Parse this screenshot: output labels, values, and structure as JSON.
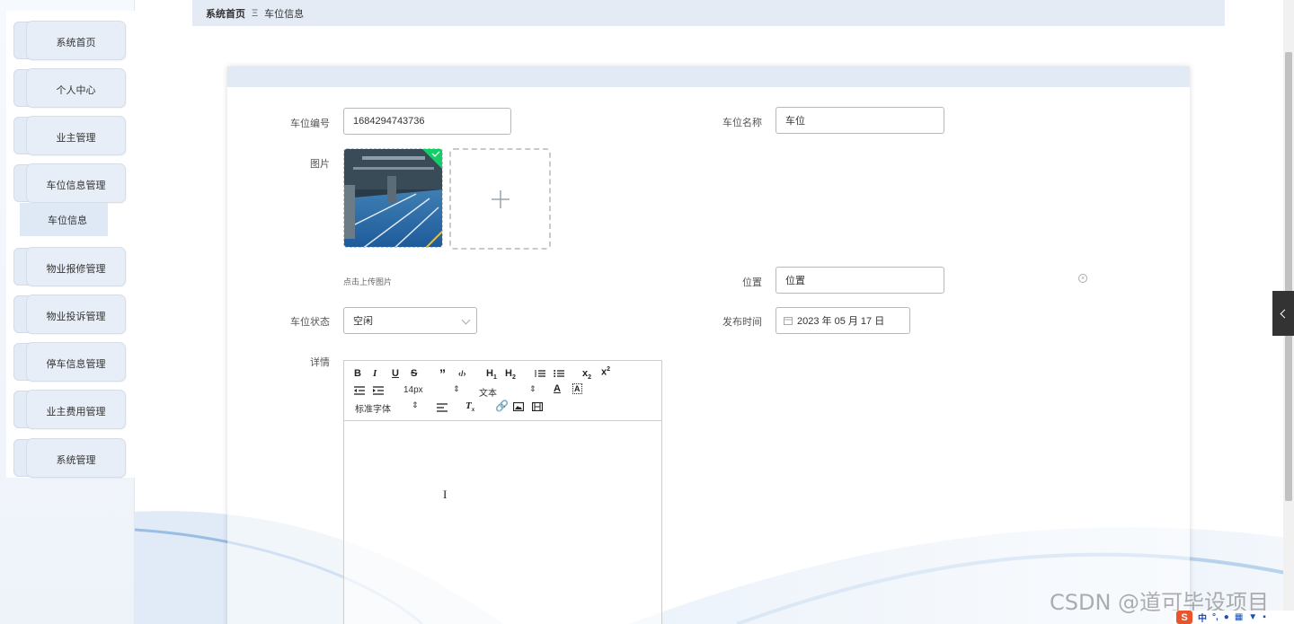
{
  "breadcrumb": {
    "home": "系统首页",
    "separator": "Ξ",
    "current": "车位信息"
  },
  "sidebar": {
    "items": [
      {
        "label": "系统首页"
      },
      {
        "label": "个人中心"
      },
      {
        "label": "业主管理"
      },
      {
        "label": "车位信息管理"
      },
      {
        "label": "物业报修管理"
      },
      {
        "label": "物业投诉管理"
      },
      {
        "label": "停车信息管理"
      },
      {
        "label": "业主费用管理"
      },
      {
        "label": "系统管理"
      }
    ],
    "submenu": {
      "label": "车位信息"
    }
  },
  "form": {
    "code_label": "车位编号",
    "code_value": "1684294743736",
    "name_label": "车位名称",
    "name_value": "车位",
    "image_label": "图片",
    "upload_tip": "点击上传图片",
    "location_label": "位置",
    "location_value": "位置",
    "status_label": "车位状态",
    "status_value": "空闲",
    "publish_label": "发布时间",
    "publish_value": "2023 年 05 月 17 日",
    "detail_label": "详情"
  },
  "editor": {
    "font_size": "14px",
    "header_select": "文本",
    "font_family": "标准字体"
  },
  "watermark": "CSDN @道可毕设项目",
  "ime": {
    "logo": "S",
    "mode": "中"
  },
  "colors": {
    "accent": "#e2eaf6",
    "sidebar_item": "#e8eef7",
    "green_corner": "#13ce66"
  }
}
